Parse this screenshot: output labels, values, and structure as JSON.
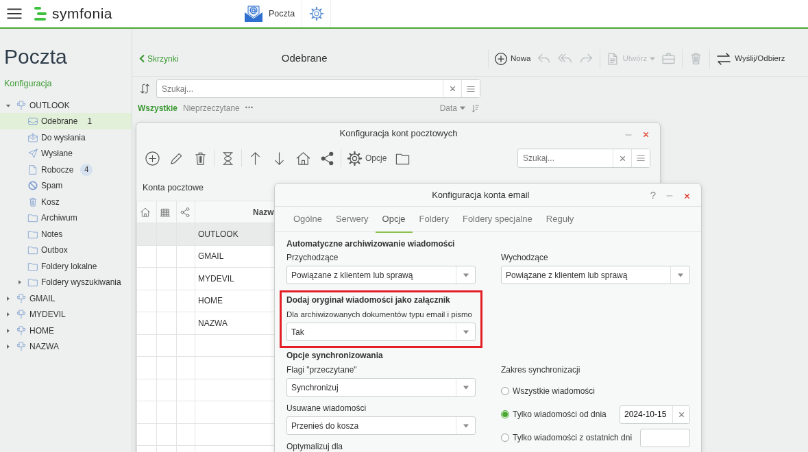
{
  "app": {
    "logo": "symfonia",
    "module": "Poczta"
  },
  "sidebar": {
    "title": "Poczta",
    "link": "Konfiguracja",
    "tree": [
      {
        "label": "OUTLOOK",
        "kind": "account",
        "expandable": true,
        "expanded": true,
        "selected": false,
        "children": [
          {
            "label": "Odebrane",
            "kind": "inbox",
            "selected": true,
            "count": "1",
            "count_badge": false
          },
          {
            "label": "Do wysłania",
            "kind": "outbox",
            "selected": false
          },
          {
            "label": "Wysłane",
            "kind": "sent",
            "selected": false
          },
          {
            "label": "Robocze",
            "kind": "drafts",
            "selected": false,
            "count": "4",
            "count_badge": true
          },
          {
            "label": "Spam",
            "kind": "spam",
            "selected": false
          },
          {
            "label": "Kosz",
            "kind": "trash",
            "selected": false
          },
          {
            "label": "Archiwum",
            "kind": "folder",
            "selected": false
          },
          {
            "label": "Notes",
            "kind": "folder",
            "selected": false
          },
          {
            "label": "Outbox",
            "kind": "folder",
            "selected": false
          },
          {
            "label": "Foldery lokalne",
            "kind": "folder",
            "selected": false
          },
          {
            "label": "Foldery wyszukiwania",
            "kind": "folder",
            "expandable": true,
            "expanded": false,
            "selected": false
          }
        ]
      },
      {
        "label": "GMAIL",
        "kind": "account",
        "expandable": true,
        "expanded": false,
        "selected": false
      },
      {
        "label": "MYDEVIL",
        "kind": "account",
        "expandable": true,
        "expanded": false,
        "selected": false
      },
      {
        "label": "HOME",
        "kind": "account",
        "expandable": true,
        "expanded": false,
        "selected": false
      },
      {
        "label": "NAZWA",
        "kind": "account",
        "expandable": true,
        "expanded": false,
        "selected": false
      }
    ]
  },
  "mail_list": {
    "back_link": "Skrzynki",
    "title": "Odebrane",
    "search": {
      "placeholder": "Szukaj..."
    },
    "filters": [
      {
        "label": "Wszystkie",
        "selected": true
      },
      {
        "label": "Nieprzeczytane",
        "selected": false
      }
    ],
    "more": "•••",
    "sort": "Data"
  },
  "toolbar_groups": [
    [
      {
        "kind": "new",
        "label": "Nowa",
        "disabled": false
      },
      {
        "kind": "reply",
        "disabled": true
      },
      {
        "kind": "reply_all",
        "disabled": true
      },
      {
        "kind": "forward",
        "disabled": true
      }
    ],
    [
      {
        "kind": "create",
        "label": "Utwórz",
        "dropdown": true,
        "disabled": true
      },
      {
        "kind": "briefcase",
        "disabled": true
      }
    ],
    [
      {
        "kind": "trash",
        "disabled": true
      }
    ],
    [
      {
        "kind": "send_receive",
        "label": "Wyślij/Odbierz",
        "disabled": false
      }
    ]
  ],
  "accounts_window": {
    "title": "Konfiguracja kont pocztowych",
    "toolbar_groups": [
      [
        {
          "kind": "add"
        },
        {
          "kind": "edit"
        },
        {
          "kind": "delete"
        }
      ],
      [
        {
          "kind": "hourglass"
        }
      ],
      [
        {
          "kind": "up"
        },
        {
          "kind": "down"
        },
        {
          "kind": "home"
        },
        {
          "kind": "share"
        }
      ],
      [
        {
          "kind": "options",
          "label": "Opcje"
        },
        {
          "kind": "folder"
        }
      ]
    ],
    "search": {
      "placeholder": "Szukaj..."
    },
    "section_title": "Konta pocztowe",
    "columns": [
      {
        "kind": "home"
      },
      {
        "kind": "building"
      },
      {
        "kind": "share"
      },
      {
        "kind": "text",
        "label": "Nazw"
      }
    ],
    "rows": [
      {
        "name": "OUTLOOK",
        "selected": true
      },
      {
        "name": "GMAIL",
        "selected": false
      },
      {
        "name": "MYDEVIL",
        "selected": false
      },
      {
        "name": "HOME",
        "selected": false
      },
      {
        "name": "NAZWA",
        "selected": false
      }
    ]
  },
  "account_dialog": {
    "title": "Konfiguracja konta email",
    "help": "?",
    "tabs": [
      {
        "label": "Ogólne",
        "selected": false
      },
      {
        "label": "Serwery",
        "selected": false
      },
      {
        "label": "Opcje",
        "selected": true
      },
      {
        "label": "Foldery",
        "selected": false
      },
      {
        "label": "Foldery specjalne",
        "selected": false
      },
      {
        "label": "Reguły",
        "selected": false
      }
    ],
    "archive": {
      "heading": "Automatyczne archiwizowanie wiadomości",
      "incoming": {
        "label": "Przychodzące",
        "value": "Powiązane z klientem lub sprawą"
      },
      "outgoing": {
        "label": "Wychodzące",
        "value": "Powiązane z klientem lub sprawą"
      }
    },
    "attach_original": {
      "highlighted": true,
      "heading": "Dodaj oryginał wiadomości jako załącznik",
      "label": "Dla archiwizowanych dokumentów typu email i pismo",
      "value": "Tak"
    },
    "sync": {
      "heading": "Opcje synchronizowania",
      "read_flags": {
        "label": "Flagi \"przeczytane\"",
        "value": "Synchronizuj"
      },
      "deleted": {
        "label": "Usuwane wiadomości",
        "value": "Przenieś do kosza"
      },
      "optimize": {
        "label": "Optymalizuj dla"
      },
      "range": {
        "label": "Zakres synchronizacji",
        "options": [
          {
            "label": "Wszystkie wiadomości",
            "selected": false
          },
          {
            "label": "Tylko wiadomości od dnia",
            "selected": true,
            "field": {
              "kind": "date",
              "value": "2024-10-15"
            }
          },
          {
            "label": "Tylko wiadomości z ostatnich dni",
            "selected": false,
            "field": {
              "kind": "number"
            }
          }
        ]
      }
    }
  }
}
